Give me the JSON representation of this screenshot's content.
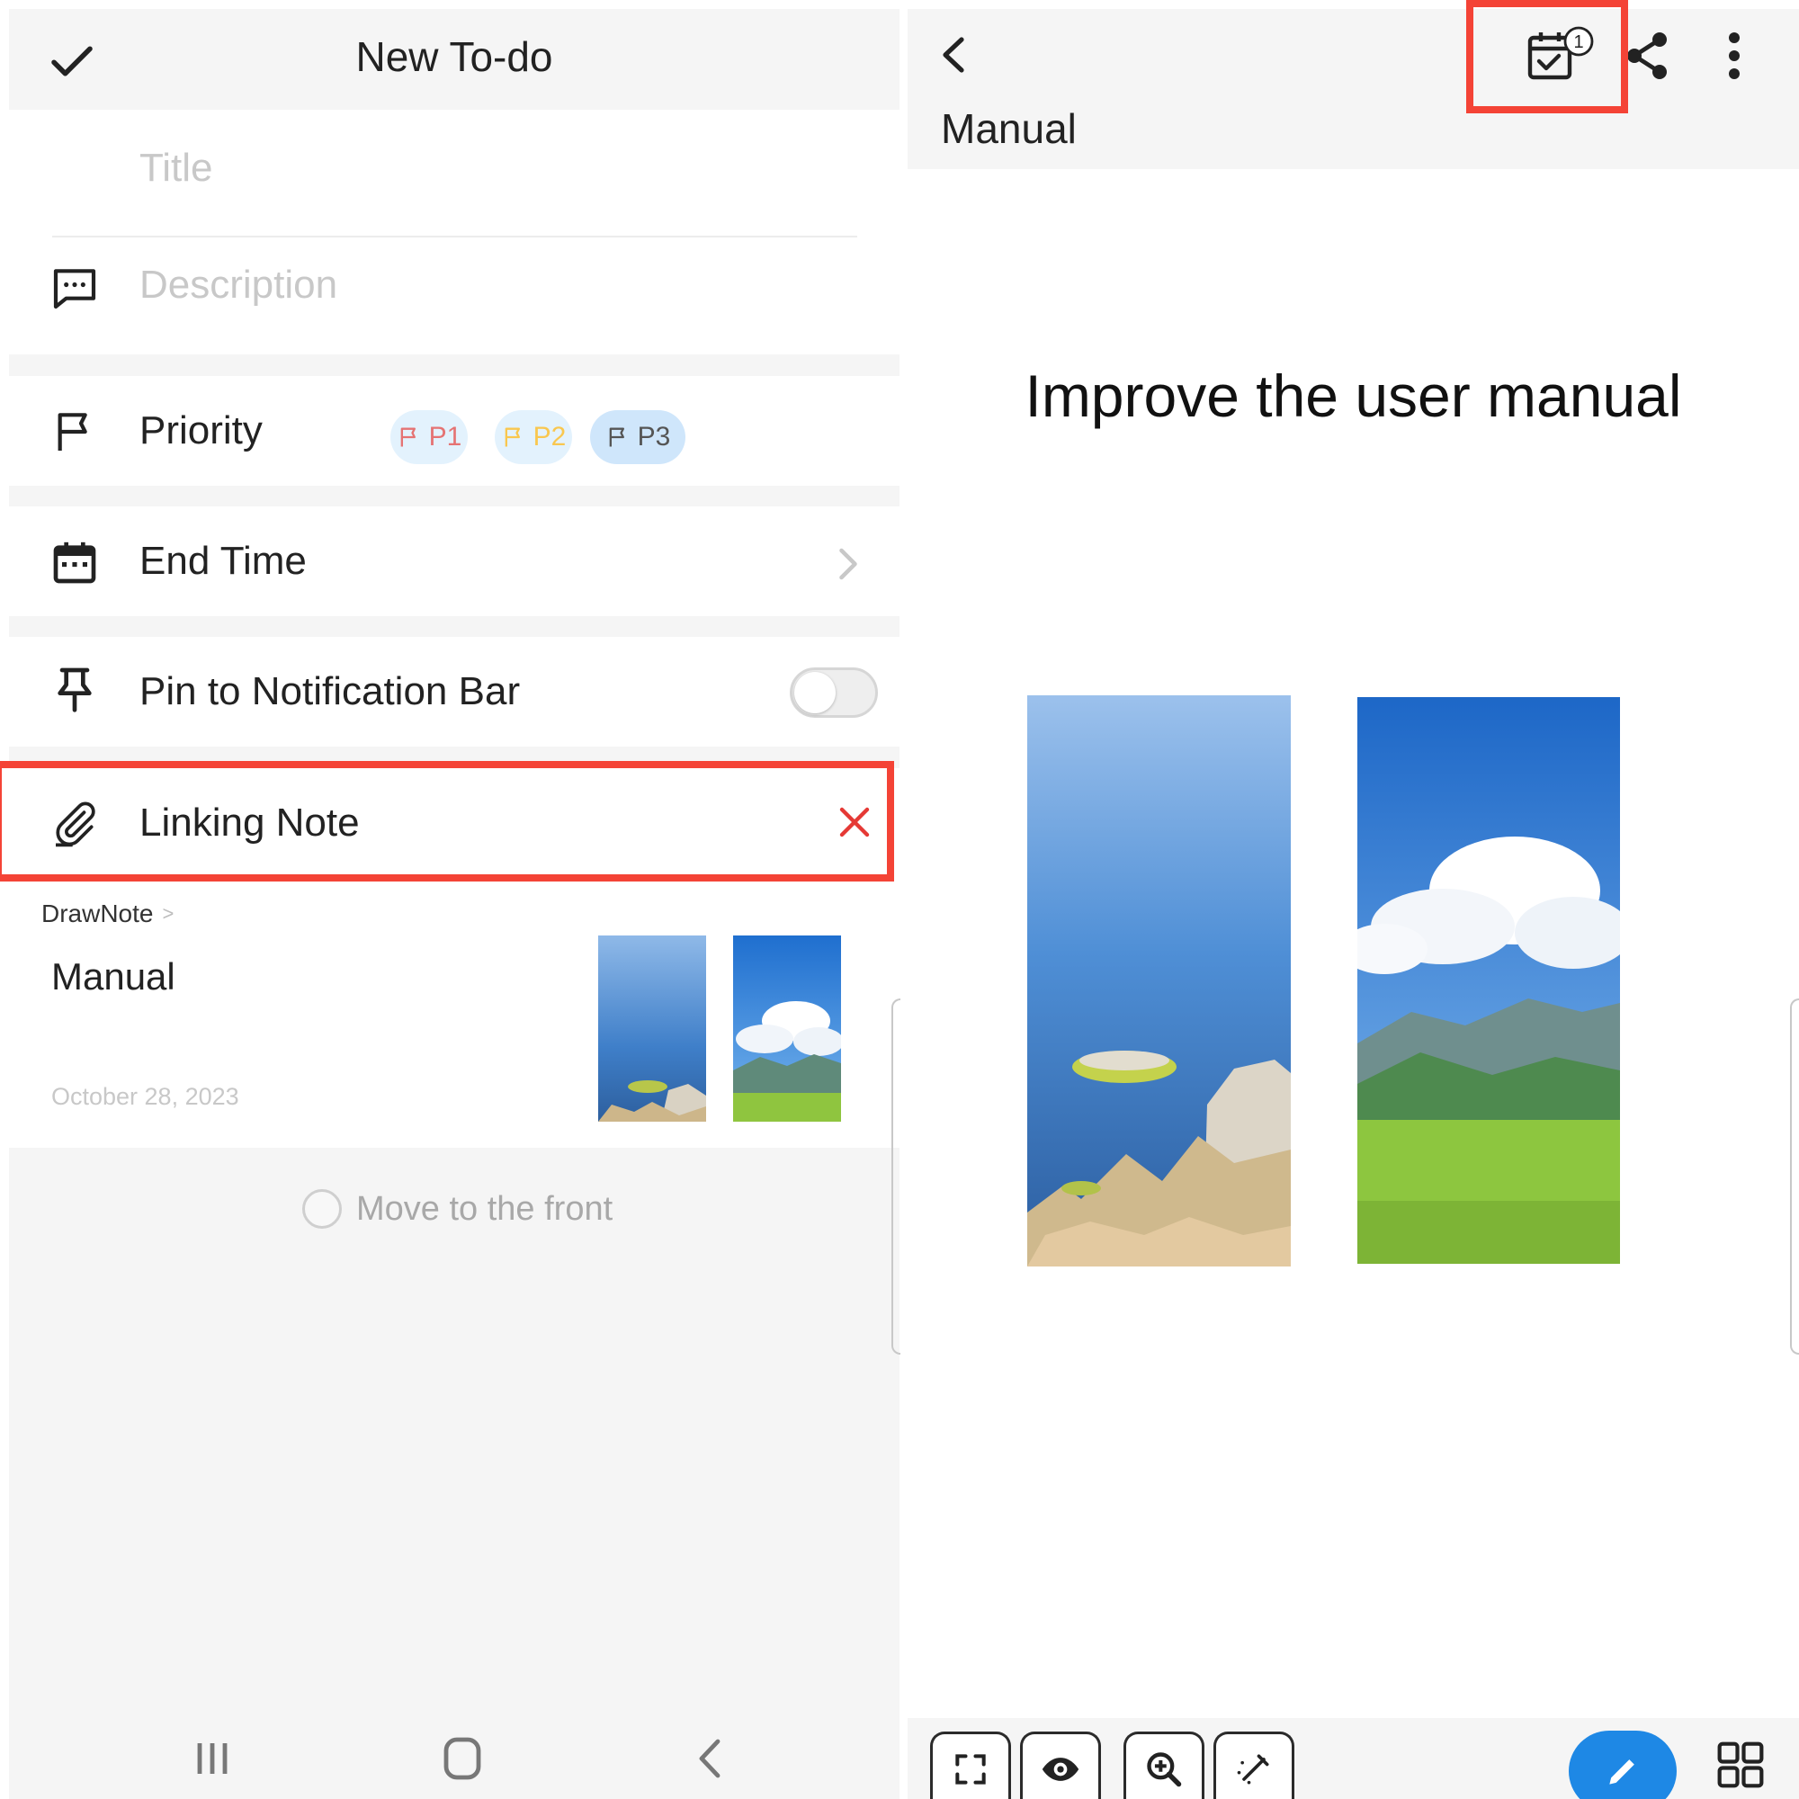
{
  "left": {
    "header": {
      "title": "New To-do",
      "confirm_icon": "check-icon"
    },
    "title_placeholder": "Title",
    "description_placeholder": "Description",
    "priority": {
      "label": "Priority",
      "chips": [
        {
          "label": "P1",
          "color": "#e57373"
        },
        {
          "label": "P2",
          "color": "#f9c74f"
        },
        {
          "label": "P3",
          "color": "#555555"
        }
      ]
    },
    "end_time": {
      "label": "End Time"
    },
    "pin": {
      "label": "Pin to Notification Bar",
      "enabled": false
    },
    "linking_note": {
      "label": "Linking Note"
    },
    "linked_note": {
      "source": "DrawNote",
      "title": "Manual",
      "date": "October 28, 2023"
    },
    "move_to_front": {
      "label": "Move to the front",
      "checked": false
    },
    "nav": [
      "recent-apps-icon",
      "home-icon",
      "back-icon"
    ]
  },
  "right": {
    "header": {
      "title": "Manual",
      "todo_badge_count": "1",
      "icons": [
        "back-icon",
        "todo-calendar-icon",
        "share-icon",
        "more-icon"
      ]
    },
    "heading": "Improve the user manual",
    "toolbar": {
      "tools": [
        "fullscreen-icon",
        "eye-icon",
        "zoom-in-icon",
        "magic-wand-icon"
      ],
      "primary": "pen-icon",
      "grid": "grid-icon"
    }
  },
  "colors": {
    "accent_red": "#f44336",
    "accent_blue": "#1e88e5",
    "chip_bg": "#e3f2fd"
  }
}
